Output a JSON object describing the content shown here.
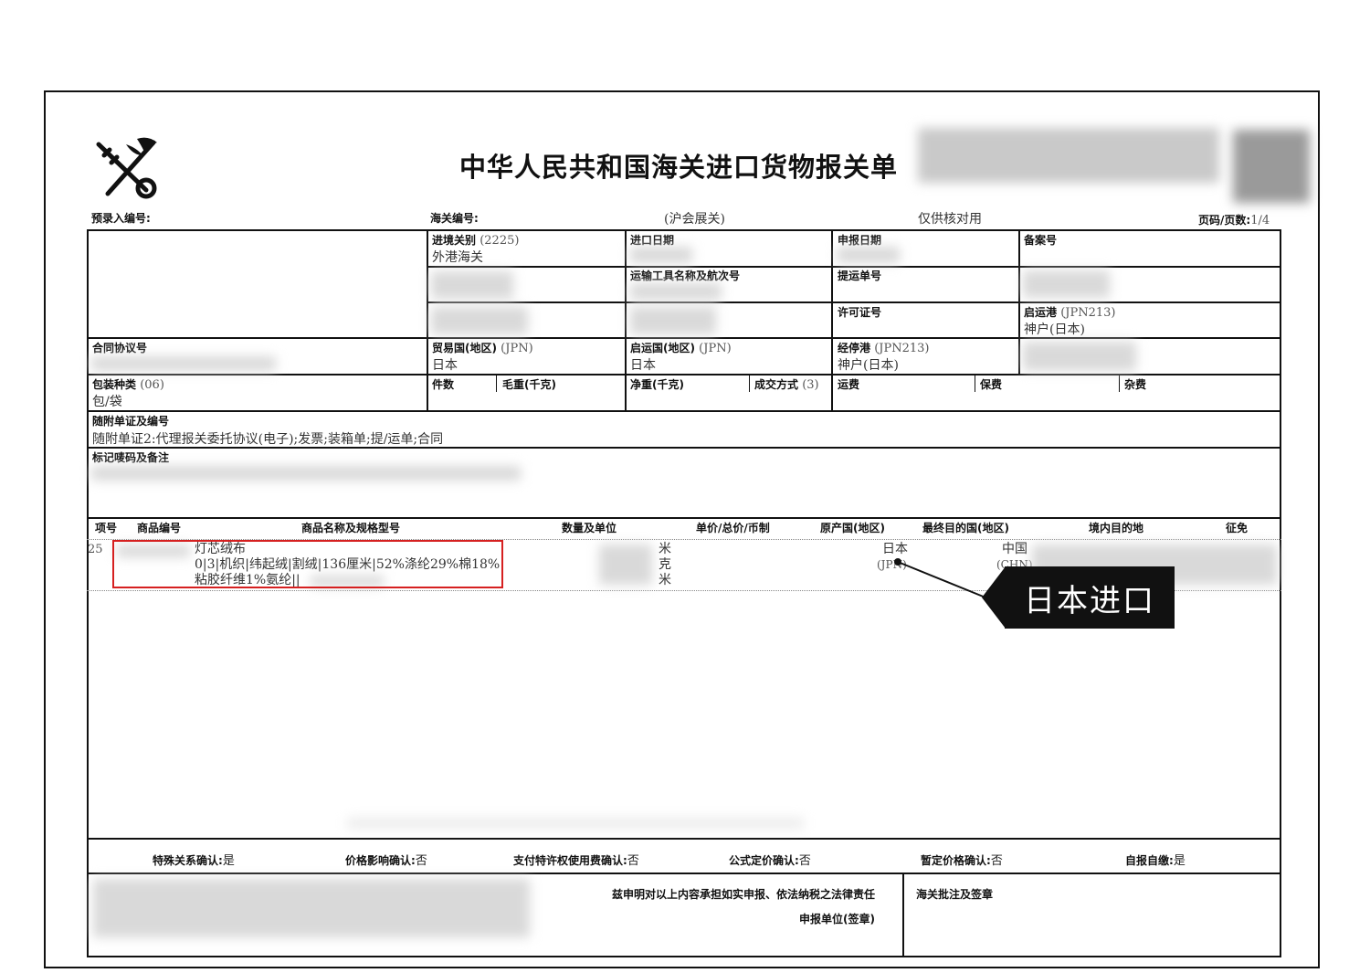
{
  "title": "中华人民共和国海关进口货物报关单",
  "meta": {
    "pre_entry_label": "预录入编号:",
    "customs_no_label": "海关编号:",
    "customs_office": "(沪会展关)",
    "verify_note": "仅供核对用",
    "page_label": "页码/页数:",
    "page_value": "1/4"
  },
  "fields": {
    "entry_customs": {
      "label": "进境关别",
      "code": "(2225)",
      "value": "外港海关"
    },
    "entry_date": {
      "label": "进口日期"
    },
    "declare_date": {
      "label": "申报日期"
    },
    "record_no": {
      "label": "备案号"
    },
    "transport": {
      "label": "运输工具名称及航次号"
    },
    "bill_no": {
      "label": "提运单号"
    },
    "license_no": {
      "label": "许可证号"
    },
    "depart_port": {
      "label": "启运港",
      "code": "(JPN213)",
      "value": "神户(日本)"
    },
    "contract_no": {
      "label": "合同协议号"
    },
    "trade_country": {
      "label": "贸易国(地区)",
      "code": "(JPN)",
      "value": "日本"
    },
    "depart_country": {
      "label": "启运国(地区)",
      "code": "(JPN)",
      "value": "日本"
    },
    "stop_port": {
      "label": "经停港",
      "code": "(JPN213)",
      "value": "神户(日本)"
    },
    "package_type": {
      "label": "包装种类",
      "code": "(06)",
      "value": "包/袋"
    },
    "pieces": {
      "label": "件数"
    },
    "gross_weight": {
      "label": "毛重(千克)"
    },
    "net_weight": {
      "label": "净重(千克)"
    },
    "deal_mode": {
      "label": "成交方式",
      "code": "(3)"
    },
    "freight": {
      "label": "运费"
    },
    "insurance": {
      "label": "保费"
    },
    "misc_fee": {
      "label": "杂费"
    },
    "attached_docs": {
      "label": "随附单证及编号",
      "value": "随附单证2:代理报关委托协议(电子);发票;装箱单;提/运单;合同"
    },
    "marks": {
      "label": "标记唛码及备注"
    }
  },
  "goods_headers": [
    "项号",
    "商品编号",
    "商品名称及规格型号",
    "数量及单位",
    "单价/总价/币制",
    "原产国(地区)",
    "最终目的国(地区)",
    "境内目的地",
    "征免"
  ],
  "goods_row": {
    "item_no": "25",
    "name_line1": "灯芯绒布",
    "name_line2": "0|3|机织|纬起绒|割绒|136厘米|52%涤纶29%棉18%",
    "name_line3": "粘胶纤维1%氨纶||",
    "units": [
      "米",
      "克",
      "米"
    ],
    "origin": "日本",
    "origin_code": "(JPN)",
    "destination": "中国",
    "destination_code": "(CHN)"
  },
  "callout": "日本进口",
  "confirm": [
    {
      "label": "特殊关系确认:",
      "value": "是"
    },
    {
      "label": "价格影响确认:",
      "value": "否"
    },
    {
      "label": "支付特许权使用费确认:",
      "value": "否"
    },
    {
      "label": "公式定价确认:",
      "value": "否"
    },
    {
      "label": "暂定价格确认:",
      "value": "否"
    },
    {
      "label": "自报自缴:",
      "value": "是"
    }
  ],
  "declaration": {
    "statement": "兹申明对以上内容承担如实申报、依法纳税之法律责任",
    "unit": "申报单位(签章)",
    "approval": "海关批注及签章"
  }
}
